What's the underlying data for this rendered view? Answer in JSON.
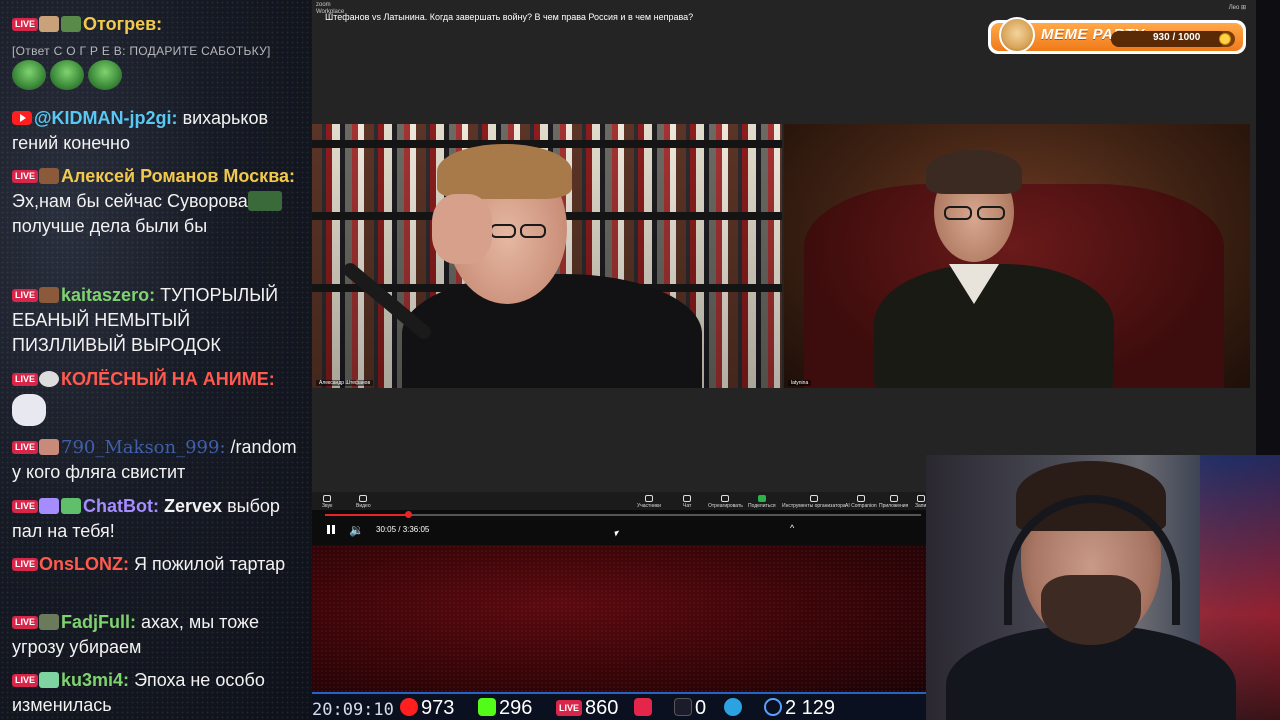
{
  "colors": {
    "youtube_red": "#ff1f1f",
    "live_badge": "#d8264a",
    "nick_gold": "#f2c94c",
    "nick_green": "#7fd36e",
    "nick_cyan": "#59c8f2",
    "nick_red": "#ff5a4d",
    "nick_orange": "#ff8c42",
    "nick_purple": "#a58cff",
    "kick_green": "#53fc18",
    "meme_orange": "#f07a1a"
  },
  "chat": {
    "m1": {
      "nick": "Отогрев:"
    },
    "m2": {
      "reply": "[Ответ С О Г Р Е В: ПОДАРИТЕ САБОТЬКУ]"
    },
    "m3": {
      "nick": "@KIDMAN-jp2gi:",
      "text": "вихарьков гений конечно"
    },
    "m4": {
      "nick": "Алексей Романов Москва:",
      "text": "Эх,нам бы сейчас Суворова",
      "text2": "получше дела были бы"
    },
    "m5": {
      "nick": "kaitaszero:",
      "text": "ТУПОРЫЛЫЙ ЕБАНЫЙ НЕМЫТЫЙ ПИЗЛЛИВЫЙ ВЫРОДОК"
    },
    "m6": {
      "nick": "КОЛЁСНЫЙ НА АНИМЕ:"
    },
    "m7": {
      "nick": "790_Makson_999:",
      "text": "/random у кого фляга свистит"
    },
    "m8": {
      "nick": "ChatBot:",
      "bold": "Zervex",
      "text": "выбор пал на тебя!"
    },
    "m9": {
      "nick": "OnsLONZ:",
      "text": "Я пожилой тартар"
    },
    "m10": {
      "nick": "FadjFull:",
      "text": "ахах, мы тоже угрозу убираем"
    },
    "m11": {
      "nick": "ku3mi4:",
      "text": "Эпоха не особо изменилась"
    }
  },
  "zoom": {
    "brand": "zoom\nWorkplace",
    "title": "Штефанов vs Латынина. Когда завершать войну? В чем права Россия и в чем неправа?",
    "mini": "Лео ⊞",
    "tile_left_name": "Александр Штефанов",
    "tile_right_name": "latynina",
    "toolbar": [
      {
        "label": "Звук",
        "icon": "mic-icon"
      },
      {
        "label": "Видео",
        "icon": "video-icon"
      },
      {
        "label": "Участники",
        "icon": "participants-icon"
      },
      {
        "label": "Чат",
        "icon": "chat-icon"
      },
      {
        "label": "Отреагировать",
        "icon": "heart-icon"
      },
      {
        "label": "Поделиться",
        "icon": "share-icon"
      },
      {
        "label": "Инструменты организатора",
        "icon": "shield-icon"
      },
      {
        "label": "AI Companion",
        "icon": "sparkle-icon"
      },
      {
        "label": "Приложения",
        "icon": "apps-icon"
      },
      {
        "label": "Запи",
        "icon": "record-icon"
      }
    ]
  },
  "meme_party": {
    "title": "MEME PARTY",
    "progress_text": "930 / 1000",
    "progress": 0.93
  },
  "player": {
    "time": "30:05 / 3:36:05",
    "progress": 0.14,
    "volume_icon": "volume-icon",
    "chevron": "^"
  },
  "stats": {
    "clock": "20:09:10",
    "youtube": "973",
    "kick": "296",
    "live_label": "LIVE",
    "live": "860",
    "rutube": "0",
    "followers": "2 129"
  }
}
